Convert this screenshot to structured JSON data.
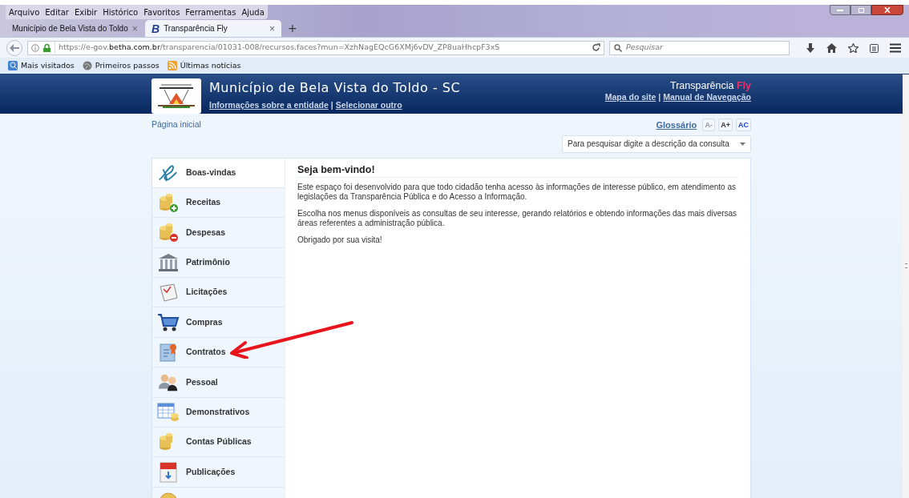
{
  "menu_bar": [
    "Arquivo",
    "Editar",
    "Exibir",
    "Histórico",
    "Favoritos",
    "Ferramentas",
    "Ajuda"
  ],
  "tabs": [
    {
      "label": "Município de Bela Vista do Toldo",
      "selected": false,
      "close": "×"
    },
    {
      "label": "Transparência Fly",
      "selected": true,
      "close": "×",
      "icon": "B"
    }
  ],
  "new_tab": "+",
  "address": {
    "url_prefix": "https://e-gov.",
    "url_domain": "betha.com.br",
    "url_rest": "/transparencia/01031-008/recursos.faces?mun=XzhNagEQcG6XMj6vDV_ZP8uaHhcpF3xS"
  },
  "search": {
    "placeholder": "Pesquisar"
  },
  "bookmarks": [
    {
      "label": "Mais visitados",
      "kind": "globe-blue"
    },
    {
      "label": "Primeiros passos",
      "kind": "globe"
    },
    {
      "label": "Últimas notícias",
      "kind": "rss"
    }
  ],
  "header": {
    "title": "Município de Bela Vista do Toldo - SC",
    "links": [
      "Informações sobre a entidade",
      "Selecionar outro"
    ],
    "separator": "|",
    "right_separator": "|",
    "brand": "Transparência",
    "brand_accent": "Fly",
    "right_links": [
      "Mapa do site",
      "Manual de Navegação"
    ]
  },
  "breadcrumb": "Página inicial",
  "glossary": "Glossário",
  "font_buttons": [
    {
      "label": "A-",
      "disabled": true
    },
    {
      "label": "A+",
      "disabled": false
    },
    {
      "label": "AC",
      "disabled": false
    }
  ],
  "query_select": {
    "placeholder": "Para pesquisar digite a descrição da consulta"
  },
  "sidebar": [
    {
      "label": "Boas-vindas",
      "kind": "signature",
      "selected": true
    },
    {
      "label": "Receitas",
      "kind": "coins-plus",
      "selected": false
    },
    {
      "label": "Despesas",
      "kind": "coins-minus",
      "selected": false
    },
    {
      "label": "Patrimônio",
      "kind": "bank",
      "selected": false
    },
    {
      "label": "Licitações",
      "kind": "paper",
      "selected": false
    },
    {
      "label": "Compras",
      "kind": "cart",
      "selected": false
    },
    {
      "label": "Contratos",
      "kind": "certificate",
      "selected": false
    },
    {
      "label": "Pessoal",
      "kind": "people",
      "selected": false
    },
    {
      "label": "Demonstrativos",
      "kind": "table",
      "selected": false
    },
    {
      "label": "Contas Públicas",
      "kind": "coins",
      "selected": false
    },
    {
      "label": "Publicações",
      "kind": "pdf",
      "selected": false
    },
    {
      "kind": "coin",
      "selected": false
    }
  ],
  "welcome": {
    "title": "Seja bem-vindo!",
    "paragraphs": [
      "Este espaço foi desenvolvido para que todo cidadão tenha acesso às informações de interesse público, em atendimento as legislações da Transparência Pública e do Acesso a Informação.",
      "Escolha nos menus disponíveis as consultas de seu interesse, gerando relatórios e obtendo informações das mais diversas áreas referentes a administração pública.",
      "Obrigado por sua visita!"
    ]
  }
}
